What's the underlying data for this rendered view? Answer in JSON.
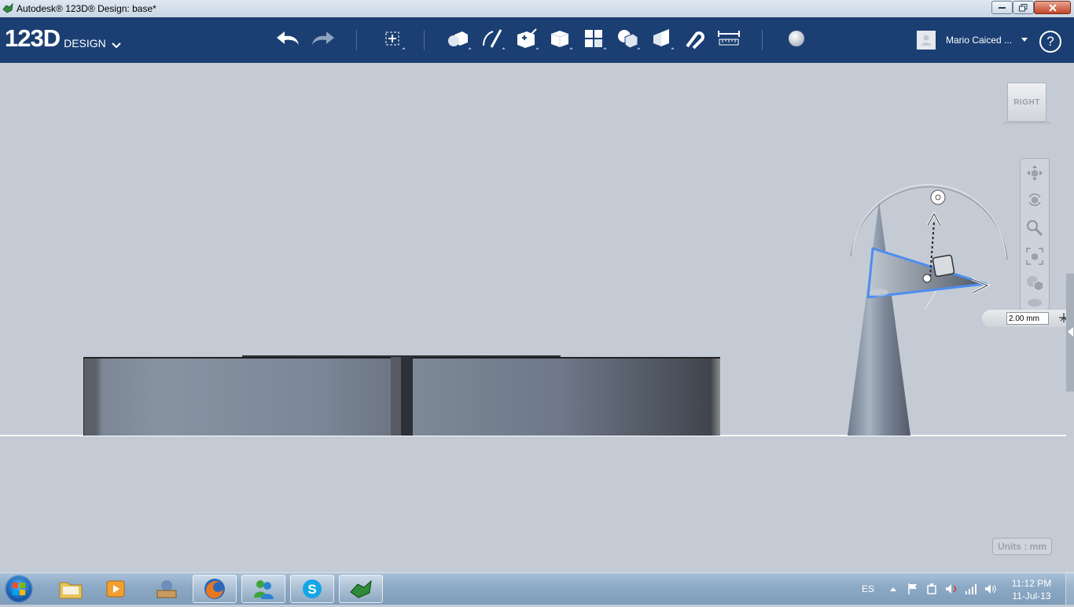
{
  "window": {
    "title": "Autodesk® 123D® Design: base*",
    "controls": [
      "minimize",
      "maximize",
      "close"
    ]
  },
  "toolbar": {
    "logo_main": "123D",
    "logo_sub": "DESIGN",
    "user_name": "Mario Caiced ...",
    "help_label": "?"
  },
  "viewport": {
    "view_cube_face": "RIGHT",
    "units_label": "Units : mm",
    "dimension_value": "2.00 mm"
  },
  "taskbar": {
    "language": "ES",
    "time": "11:12 PM",
    "date": "11-Jul-13"
  },
  "colors": {
    "toolbar_bg": "#1b3f73",
    "viewport_bg": "#c4cbd4",
    "selection_blue": "#4f8df0"
  }
}
